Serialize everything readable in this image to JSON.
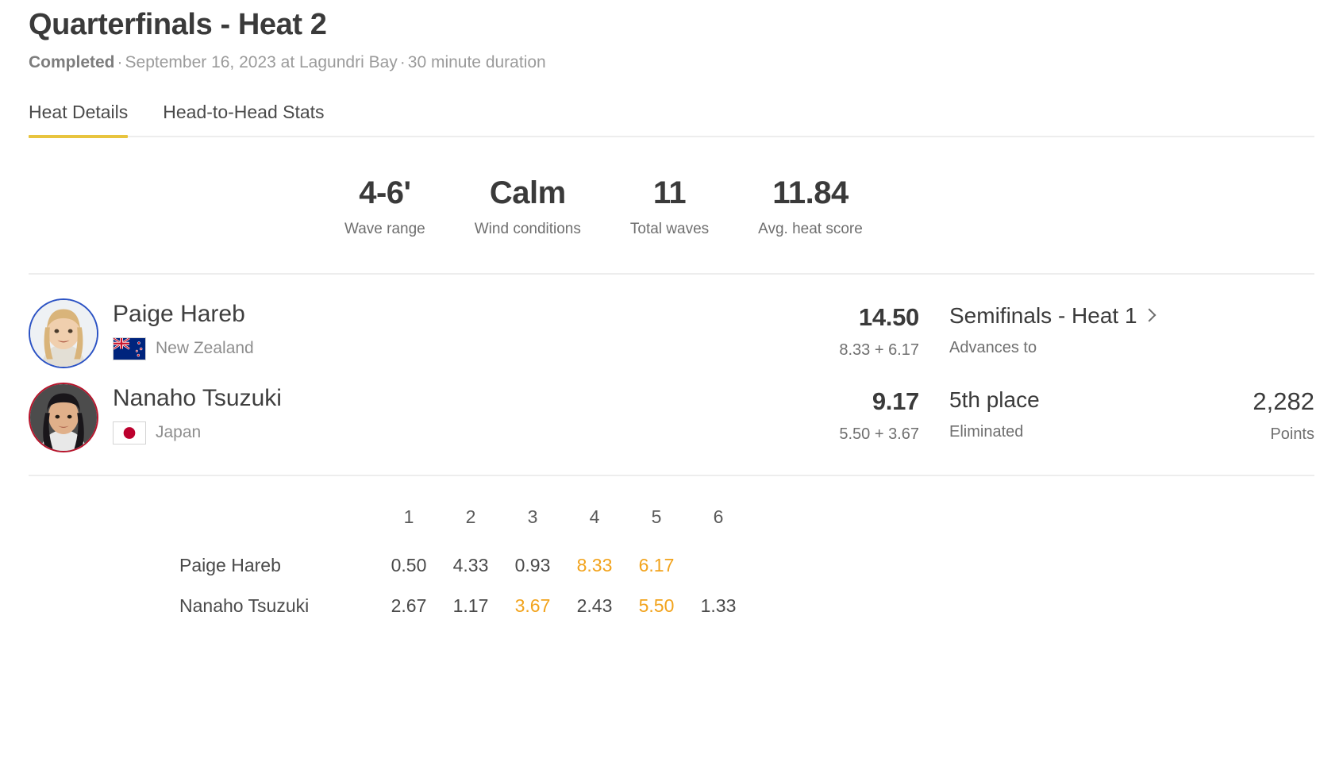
{
  "header": {
    "title": "Quarterfinals - Heat 2",
    "status": "Completed",
    "sep1": "·",
    "date_location": "September 16, 2023 at Lagundri Bay",
    "sep2": "·",
    "duration": "30 minute duration"
  },
  "tabs": [
    {
      "label": "Heat Details",
      "active": true
    },
    {
      "label": "Head-to-Head Stats",
      "active": false
    }
  ],
  "conditions": [
    {
      "value": "4-6'",
      "label": "Wave range"
    },
    {
      "value": "Calm",
      "label": "Wind conditions"
    },
    {
      "value": "11",
      "label": "Total waves"
    },
    {
      "value": "11.84",
      "label": "Avg. heat score"
    }
  ],
  "athletes": [
    {
      "name": "Paige Hareb",
      "country": "New Zealand",
      "flag": "nz-flag-icon",
      "ring_color": "#2b52c4",
      "total": "14.50",
      "breakdown": "8.33 + 6.17",
      "outcome": "Semifinals - Heat 1",
      "outcome_sub": "Advances to",
      "has_chevron": true,
      "points": "",
      "points_label": ""
    },
    {
      "name": "Nanaho Tsuzuki",
      "country": "Japan",
      "flag": "jp-flag-icon",
      "ring_color": "#b7152c",
      "total": "9.17",
      "breakdown": "5.50 + 3.67",
      "outcome": "5th place",
      "outcome_sub": "Eliminated",
      "has_chevron": false,
      "points": "2,282",
      "points_label": "Points"
    }
  ],
  "wave_table": {
    "wave_numbers": [
      "1",
      "2",
      "3",
      "4",
      "5",
      "6"
    ],
    "rows": [
      {
        "name": "Paige Hareb",
        "scores": [
          {
            "value": "0.50",
            "counted": false
          },
          {
            "value": "4.33",
            "counted": false
          },
          {
            "value": "0.93",
            "counted": false
          },
          {
            "value": "8.33",
            "counted": true
          },
          {
            "value": "6.17",
            "counted": true
          },
          {
            "value": "",
            "counted": false
          }
        ]
      },
      {
        "name": "Nanaho Tsuzuki",
        "scores": [
          {
            "value": "2.67",
            "counted": false
          },
          {
            "value": "1.17",
            "counted": false
          },
          {
            "value": "3.67",
            "counted": true
          },
          {
            "value": "2.43",
            "counted": false
          },
          {
            "value": "5.50",
            "counted": true
          },
          {
            "value": "1.33",
            "counted": false
          }
        ]
      }
    ]
  },
  "colors": {
    "accent": "#e8c43e",
    "counted_score": "#f2a31c",
    "text_primary": "#3a3a3a",
    "text_muted": "#8e8e8e"
  }
}
